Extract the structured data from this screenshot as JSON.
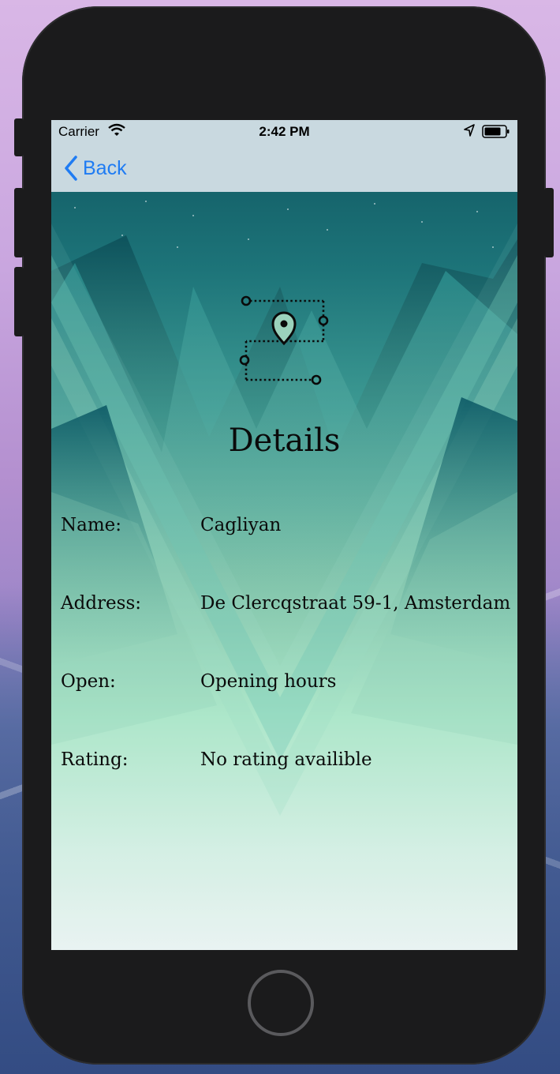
{
  "status_bar": {
    "carrier": "Carrier",
    "time": "2:42 PM",
    "icons": [
      "wifi-icon",
      "location-arrow-icon",
      "battery-icon"
    ]
  },
  "nav": {
    "back_label": "Back",
    "back_icon": "chevron-left-icon",
    "tint": "#1f7cf3"
  },
  "header": {
    "logo_icon": "map-route-pin-icon",
    "title": "Details"
  },
  "details": [
    {
      "label": "Name:",
      "value": "Cagliyan"
    },
    {
      "label": "Address:",
      "value": "De Clercqstraat 59-1, Amsterdam"
    },
    {
      "label": "Open:",
      "value": "Opening hours"
    },
    {
      "label": "Rating:",
      "value": "No rating availible"
    }
  ],
  "device": {
    "home_button_icon": "home-button-icon"
  }
}
